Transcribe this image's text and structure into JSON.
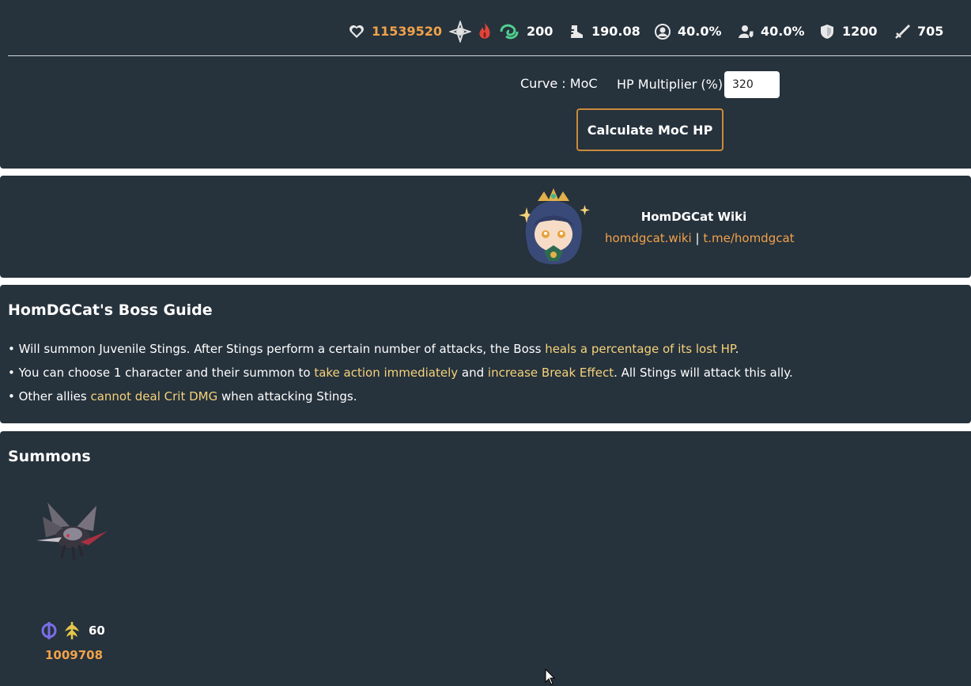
{
  "stats": {
    "hp": "11539520",
    "toughness": "200",
    "speed": "190.08",
    "effect_hit_rate": "40.0%",
    "effect_res": "40.0%",
    "defense": "1200",
    "attack": "705"
  },
  "hp_calc": {
    "curve_label": "Curve : MoC",
    "multiplier_label": "HP Multiplier (%):",
    "multiplier_value": "320",
    "button_label": "Calculate MoC HP"
  },
  "wiki": {
    "title": "HomDGCat Wiki",
    "link1": "homdgcat.wiki",
    "separator": "|",
    "link2": "t.me/homdgcat"
  },
  "guide": {
    "heading": "HomDGCat's Boss Guide",
    "lines": [
      {
        "a": "• Will summon Juvenile Stings. After Stings perform a certain number of attacks, the Boss ",
        "hl1": "heals a percentage of its lost HP",
        "b": "."
      },
      {
        "a": "• You can choose 1 character and their summon to ",
        "hl1": "take action immediately",
        "b": " and ",
        "hl2": "increase Break Effect",
        "c": ". All Stings will attack this ally."
      },
      {
        "a": "• Other allies ",
        "hl1": "cannot deal Crit DMG",
        "b": " when attacking Stings."
      }
    ]
  },
  "summons": {
    "heading": "Summons",
    "items": [
      {
        "level": "60",
        "hp": "1009708"
      }
    ]
  },
  "colors": {
    "panel_bg": "#26323c",
    "accent_orange": "#f0a24a",
    "highlight_yellow": "#f5d27a",
    "button_border": "#c98a3c"
  },
  "icons": {
    "hp": "heart-icon",
    "weakness": [
      "quantum-weakness-icon",
      "fire-weakness-icon",
      "wind-weakness-icon"
    ],
    "speed": "boot-icon",
    "effect_hit_rate": "target-icon",
    "effect_res": "resist-icon",
    "defense": "shield-icon",
    "attack": "sword-icon",
    "summon_paths": [
      "quantum-icon",
      "abundance-icon"
    ]
  }
}
